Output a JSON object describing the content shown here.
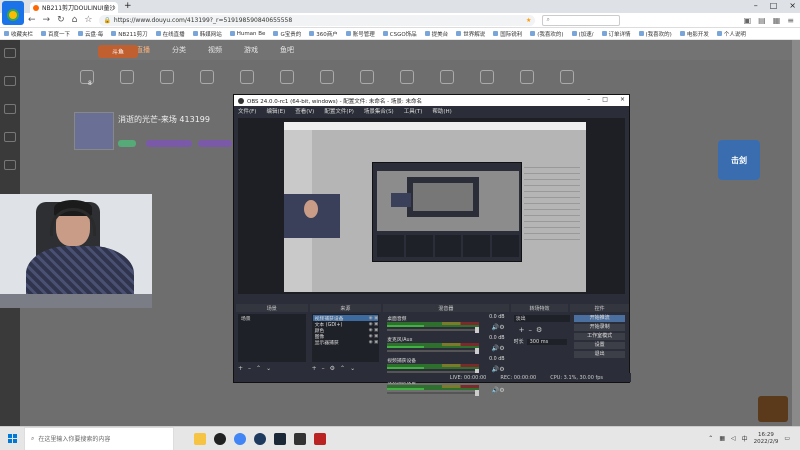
{
  "browser": {
    "tab_title": "NB211剪刀DOULINUI童沙",
    "url": "https://www.douyu.com/413199?_r=519198590840655558",
    "search_placeholder": "",
    "bookmarks": [
      "收藏夹栏",
      "百度一下",
      "云盘·每",
      "NB211剪刀",
      "在线直播",
      "韩媒网站",
      "Human Be",
      "G宝贵的",
      "360商户",
      "账号管理",
      "CSGO饰品",
      "提美台",
      "世界解说",
      "国际锐利",
      "(我喜欢的)",
      "(加速/",
      "订单详情",
      "(我喜欢的)",
      "电影开发",
      "个人说明"
    ]
  },
  "site": {
    "nav": [
      "首页",
      "直播",
      "分类",
      "视频",
      "游戏",
      "鱼吧"
    ],
    "logo": "斗鱼",
    "streamer_title": "消逝的光芒-来场 413199",
    "streamer_sub": "",
    "category_count": "8",
    "side_promo": "击剑",
    "side_promo2": "",
    "side_text": []
  },
  "webcam": {
    "label": ""
  },
  "obs": {
    "title": "OBS 24.0.0-rc1 (64-bit, windows) - 配置文件: 未命名 - 场景: 未命名",
    "menu": [
      "文件(F)",
      "编辑(E)",
      "查看(V)",
      "配置文件(P)",
      "场景集合(S)",
      "工具(T)",
      "帮助(H)"
    ],
    "docks": {
      "scenes_title": "场景",
      "sources_title": "来源",
      "mixer_title": "混音器",
      "transitions_title": "转场特效",
      "controls_title": "控件"
    },
    "scenes": [
      "场景"
    ],
    "sources": [
      "视频捕获设备",
      "文本 (GDI+)",
      "颜色",
      "图像",
      "显示器捕获"
    ],
    "mixer": [
      {
        "name": "桌面音频",
        "db": "0.0 dB"
      },
      {
        "name": "麦克风/Aux",
        "db": "0.0 dB"
      },
      {
        "name": "视频捕获设备",
        "db": "0.0 dB"
      },
      {
        "name": "视频捕获设备",
        "db": "0.0 dB"
      }
    ],
    "transition": {
      "type": "淡出",
      "duration_label": "时长",
      "duration": "300 ms"
    },
    "controls": [
      "开始推流",
      "开始录制",
      "工作室模式",
      "设置",
      "退出"
    ],
    "status": {
      "live": "LIVE: 00:00:00",
      "rec": "REC: 00:00:00",
      "cpu": "CPU: 3.1%, 30.00 fps"
    }
  },
  "taskbar": {
    "search_placeholder": "在这里输入你要搜索的内容",
    "time": "16:29",
    "date": "2022/2/9",
    "lang": "中"
  }
}
